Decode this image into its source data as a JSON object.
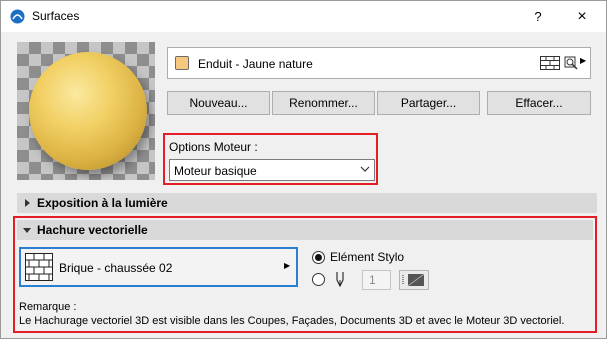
{
  "window": {
    "title": "Surfaces",
    "help_label": "?",
    "close_label": "×"
  },
  "material": {
    "name": "Enduit - Jaune nature",
    "swatch_color": "#f7c97f",
    "icons": [
      "hatch-pattern-icon",
      "eyedropper-icon",
      "arrow-right-icon"
    ]
  },
  "buttons": {
    "new": "Nouveau...",
    "rename": "Renommer...",
    "share": "Partager...",
    "delete": "Effacer..."
  },
  "engine": {
    "label": "Options Moteur :",
    "selected": "Moteur basique"
  },
  "sections": {
    "light": "Exposition à la lumière",
    "hatch": "Hachure vectorielle"
  },
  "hatch": {
    "pattern_name": "Brique - chaussée 02",
    "pen_option_label": "Elément Stylo",
    "pen_number": "1",
    "pen_option_selected": true
  },
  "note": {
    "title": "Remarque :",
    "text": "Le Hachurage vectoriel 3D est visible dans les Coupes, Façades, Documents 3D et avec le Moteur 3D vectoriel."
  },
  "colors": {
    "highlight_border": "#e41e25",
    "focus_border": "#2a7fd4"
  }
}
